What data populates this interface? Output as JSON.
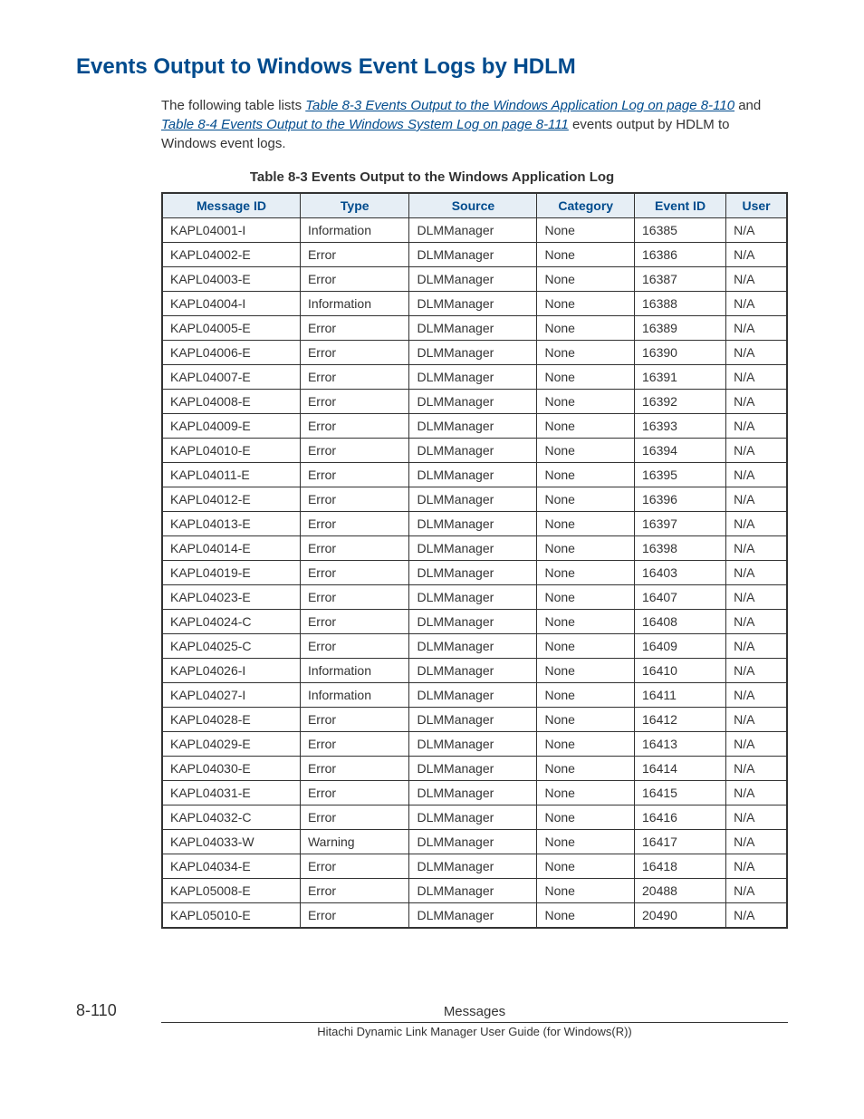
{
  "heading": "Events Output to Windows Event Logs by HDLM",
  "intro": {
    "prefix": "The following table lists ",
    "link1": "Table 8-3 Events Output to the Windows Application Log on page 8-110",
    "mid": " and ",
    "link2": "Table 8-4 Events Output to the Windows System Log on page 8-111",
    "suffix": " events output by HDLM to Windows event logs."
  },
  "table": {
    "caption": "Table 8-3 Events Output to the Windows Application Log",
    "headers": [
      "Message ID",
      "Type",
      "Source",
      "Category",
      "Event ID",
      "User"
    ],
    "rows": [
      [
        "KAPL04001-I",
        "Information",
        "DLMManager",
        "None",
        "16385",
        "N/A"
      ],
      [
        "KAPL04002-E",
        "Error",
        "DLMManager",
        "None",
        "16386",
        "N/A"
      ],
      [
        "KAPL04003-E",
        "Error",
        "DLMManager",
        "None",
        "16387",
        "N/A"
      ],
      [
        "KAPL04004-I",
        "Information",
        "DLMManager",
        "None",
        "16388",
        "N/A"
      ],
      [
        "KAPL04005-E",
        "Error",
        "DLMManager",
        "None",
        "16389",
        "N/A"
      ],
      [
        "KAPL04006-E",
        "Error",
        "DLMManager",
        "None",
        "16390",
        "N/A"
      ],
      [
        "KAPL04007-E",
        "Error",
        "DLMManager",
        "None",
        "16391",
        "N/A"
      ],
      [
        "KAPL04008-E",
        "Error",
        "DLMManager",
        "None",
        "16392",
        "N/A"
      ],
      [
        "KAPL04009-E",
        "Error",
        "DLMManager",
        "None",
        "16393",
        "N/A"
      ],
      [
        "KAPL04010-E",
        "Error",
        "DLMManager",
        "None",
        "16394",
        "N/A"
      ],
      [
        "KAPL04011-E",
        "Error",
        "DLMManager",
        "None",
        "16395",
        "N/A"
      ],
      [
        "KAPL04012-E",
        "Error",
        "DLMManager",
        "None",
        "16396",
        "N/A"
      ],
      [
        "KAPL04013-E",
        "Error",
        "DLMManager",
        "None",
        "16397",
        "N/A"
      ],
      [
        "KAPL04014-E",
        "Error",
        "DLMManager",
        "None",
        "16398",
        "N/A"
      ],
      [
        "KAPL04019-E",
        "Error",
        "DLMManager",
        "None",
        "16403",
        "N/A"
      ],
      [
        "KAPL04023-E",
        "Error",
        "DLMManager",
        "None",
        "16407",
        "N/A"
      ],
      [
        "KAPL04024-C",
        "Error",
        "DLMManager",
        "None",
        "16408",
        "N/A"
      ],
      [
        "KAPL04025-C",
        "Error",
        "DLMManager",
        "None",
        "16409",
        "N/A"
      ],
      [
        "KAPL04026-I",
        "Information",
        "DLMManager",
        "None",
        "16410",
        "N/A"
      ],
      [
        "KAPL04027-I",
        "Information",
        "DLMManager",
        "None",
        "16411",
        "N/A"
      ],
      [
        "KAPL04028-E",
        "Error",
        "DLMManager",
        "None",
        "16412",
        "N/A"
      ],
      [
        "KAPL04029-E",
        "Error",
        "DLMManager",
        "None",
        "16413",
        "N/A"
      ],
      [
        "KAPL04030-E",
        "Error",
        "DLMManager",
        "None",
        "16414",
        "N/A"
      ],
      [
        "KAPL04031-E",
        "Error",
        "DLMManager",
        "None",
        "16415",
        "N/A"
      ],
      [
        "KAPL04032-C",
        "Error",
        "DLMManager",
        "None",
        "16416",
        "N/A"
      ],
      [
        "KAPL04033-W",
        "Warning",
        "DLMManager",
        "None",
        "16417",
        "N/A"
      ],
      [
        "KAPL04034-E",
        "Error",
        "DLMManager",
        "None",
        "16418",
        "N/A"
      ],
      [
        "KAPL05008-E",
        "Error",
        "DLMManager",
        "None",
        "20488",
        "N/A"
      ],
      [
        "KAPL05010-E",
        "Error",
        "DLMManager",
        "None",
        "20490",
        "N/A"
      ]
    ]
  },
  "footer": {
    "pageNum": "8-110",
    "centerTop": "Messages",
    "centerBottom": "Hitachi Dynamic Link Manager User Guide (for Windows(R))"
  }
}
